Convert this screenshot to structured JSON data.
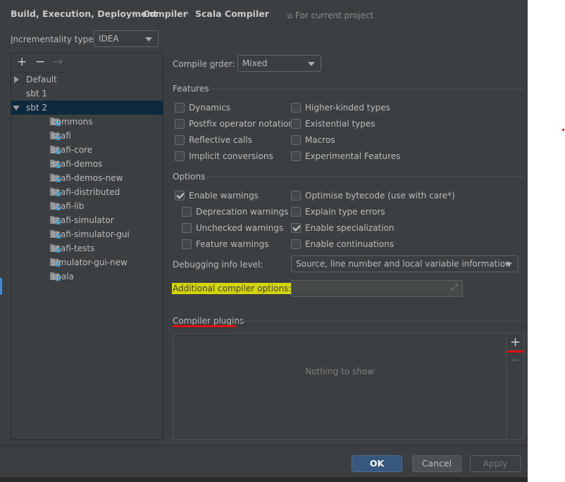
{
  "breadcrumb": [
    "Build, Execution, Deployment",
    "Compiler",
    "Scala Compiler"
  ],
  "scope_label": "For current project",
  "incrementality": {
    "label": "Incrementality type:",
    "value": "IDEA"
  },
  "tree": {
    "toolbar": [
      "+",
      "−",
      "→"
    ],
    "nodes": [
      {
        "label": "Default"
      },
      {
        "label": "sbt 1"
      },
      {
        "label": "sbt 2"
      },
      {
        "label": "commons"
      },
      {
        "label": "scafi"
      },
      {
        "label": "scafi-core"
      },
      {
        "label": "scafi-demos"
      },
      {
        "label": "scafi-demos-new"
      },
      {
        "label": "scafi-distributed"
      },
      {
        "label": "scafi-lib"
      },
      {
        "label": "scafi-simulator"
      },
      {
        "label": "scafi-simulator-gui"
      },
      {
        "label": "scafi-tests"
      },
      {
        "label": "simulator-gui-new"
      },
      {
        "label": "spala"
      }
    ]
  },
  "compile_order": {
    "label": "Compile order:",
    "value": "Mixed"
  },
  "features": {
    "title": "Features",
    "items": [
      {
        "label": "Dynamics",
        "checked": false
      },
      {
        "label": "Postfix operator notation",
        "checked": false
      },
      {
        "label": "Reflective calls",
        "checked": false
      },
      {
        "label": "Implicit conversions",
        "checked": false
      },
      {
        "label": "Higher-kinded types",
        "checked": false
      },
      {
        "label": "Existential types",
        "checked": false
      },
      {
        "label": "Macros",
        "checked": false
      },
      {
        "label": "Experimental Features",
        "checked": false
      }
    ]
  },
  "options": {
    "title": "Options",
    "items": [
      {
        "label": "Enable warnings",
        "checked": true
      },
      {
        "label": "Deprecation warnings",
        "checked": false
      },
      {
        "label": "Unchecked warnings",
        "checked": false
      },
      {
        "label": "Feature warnings",
        "checked": false
      },
      {
        "label": "Optimise bytecode (use with care*)",
        "checked": false
      },
      {
        "label": "Explain type errors",
        "checked": false
      },
      {
        "label": "Enable specialization",
        "checked": true
      },
      {
        "label": "Enable continuations",
        "checked": false
      }
    ]
  },
  "debug_info": {
    "label": "Debugging info level:",
    "value": "Source, line number and local variable information"
  },
  "additional_options": {
    "label": "Additional compiler options:",
    "value": ""
  },
  "plugins": {
    "title": "Compiler plugins",
    "empty_text": "Nothing to show",
    "add": "+",
    "remove": "−"
  },
  "buttons": {
    "ok": "OK",
    "cancel": "Cancel",
    "apply": "Apply"
  },
  "colors": {
    "background": "#3c3f41",
    "selection": "#0d293e",
    "highlight": "#d4d400",
    "annotation_red": "#e01010",
    "ok_blue": "#365880"
  }
}
